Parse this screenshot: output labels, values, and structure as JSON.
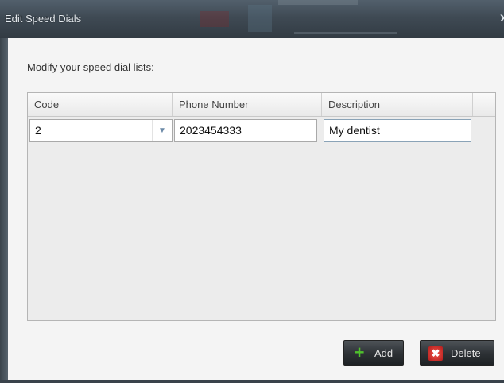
{
  "dialog": {
    "title": "Edit Speed Dials",
    "close_glyph": "x",
    "instruction": "Modify your speed dial lists:"
  },
  "grid": {
    "columns": [
      "Code",
      "Phone Number",
      "Description",
      ""
    ],
    "rows": [
      {
        "code": "2",
        "phone": "2023454333",
        "description": "My dentist"
      }
    ]
  },
  "buttons": {
    "add_label": "Add",
    "add_icon": "plus-icon",
    "delete_label": "Delete",
    "delete_icon": "x-icon"
  },
  "colors": {
    "titlebar": "#3f4a54",
    "add_icon": "#4fc12c",
    "delete_icon": "#c8261f",
    "content_bg": "#f4f4f4"
  }
}
